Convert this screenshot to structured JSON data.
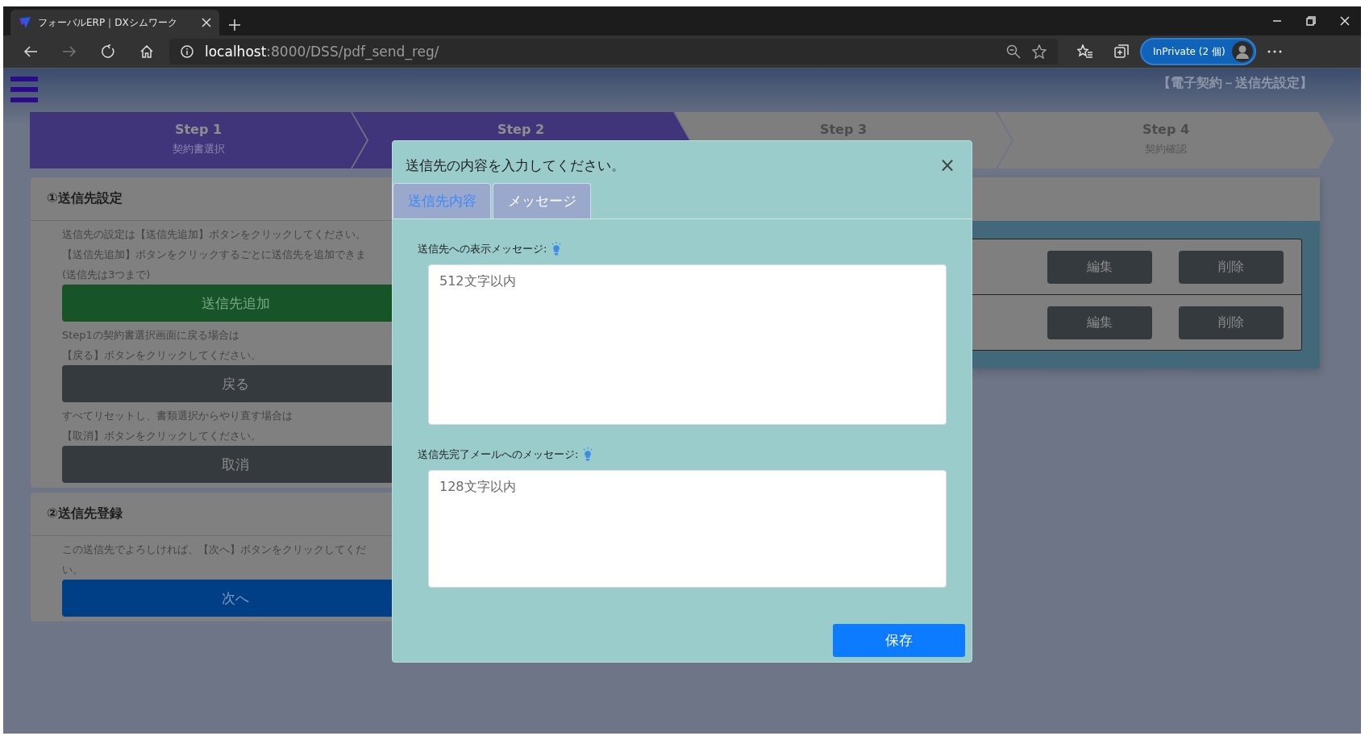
{
  "browser": {
    "tab_title": "フォーバルERP｜DXシムワーク",
    "url_host": "localhost",
    "url_path": ":8000/DSS/pdf_send_reg/",
    "profile": "InPrivate (2 個)"
  },
  "page_title": "【電子契約－送信先設定】",
  "steps": [
    {
      "label": "Step 1",
      "sub": "契約書選択",
      "active": true
    },
    {
      "label": "Step 2",
      "active": true
    },
    {
      "label": "Step 3",
      "active": false
    },
    {
      "label": "Step 4",
      "sub": "契約確認",
      "active": false
    }
  ],
  "settings_card": {
    "title": "①送信先設定",
    "blocks": [
      {
        "lines": [
          "送信先の設定は【送信先追加】ボタンをクリックしてください。",
          "【送信先追加】ボタンをクリックするごとに送信先を追加できま",
          "(送信先は3つまで)"
        ],
        "button": "送信先追加",
        "kind": "success"
      },
      {
        "lines": [
          "Step1の契約書選択画面に戻る場合は",
          "【戻る】ボタンをクリックしてください。"
        ],
        "button": "戻る",
        "kind": "dark"
      },
      {
        "lines": [
          "すべてリセットし、書類選択からやり直す場合は",
          "【取消】ボタンをクリックしてください。"
        ],
        "button": "取消",
        "kind": "dark"
      }
    ]
  },
  "register_card": {
    "title": "②送信先登録",
    "blocks": [
      {
        "lines": [
          "この送信先でよろしければ、【次へ】ボタンをクリックしてくだ",
          "い。"
        ],
        "button": "次へ",
        "kind": "primary"
      }
    ]
  },
  "recipients": [
    {
      "edit": "編集",
      "delete": "削除"
    },
    {
      "edit": "編集",
      "delete": "削除"
    }
  ],
  "modal": {
    "title": "送信先の内容を入力してください。",
    "close": "×",
    "tabs": [
      {
        "label": "送信先内容",
        "selected": false
      },
      {
        "label": "メッセージ",
        "selected": true
      }
    ],
    "fields": [
      {
        "label": "送信先への表示メッセージ:",
        "placeholder": "512文字以内",
        "kind": "long"
      },
      {
        "label": "送信先完了メールへのメッセージ:",
        "placeholder": "128文字以内",
        "kind": "short"
      }
    ],
    "save": "保存"
  }
}
